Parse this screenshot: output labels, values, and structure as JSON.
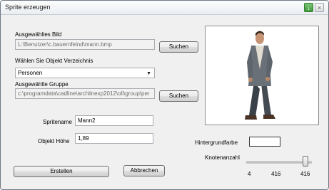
{
  "window": {
    "title": "Sprite erzeugen"
  },
  "image": {
    "label": "Ausgewähltes Bild",
    "path": "L:\\Benutzer\\c.bauernfeind\\mann.bmp",
    "search_label": "Suchen"
  },
  "directory": {
    "label": "Wählen Sie Objekt Verzeichnis",
    "selected": "Personen"
  },
  "group": {
    "label": "Ausgewählte Gruppe",
    "path": "c:\\programdata\\cadline\\archlinexp2012\\oli\\group\\per",
    "search_label": "Suchen"
  },
  "sprite": {
    "label": "Spritename",
    "value": "Mann2"
  },
  "height": {
    "label": "Objekt Höhe",
    "value": "1,89"
  },
  "background": {
    "label": "Hintergrundfarbe",
    "color": "#ffffff"
  },
  "nodes": {
    "label": "Knotenanzahl",
    "min": "4",
    "value": "416",
    "max": "416"
  },
  "buttons": {
    "create_label": "Erstellen",
    "cancel_label": "Abbrechen"
  }
}
